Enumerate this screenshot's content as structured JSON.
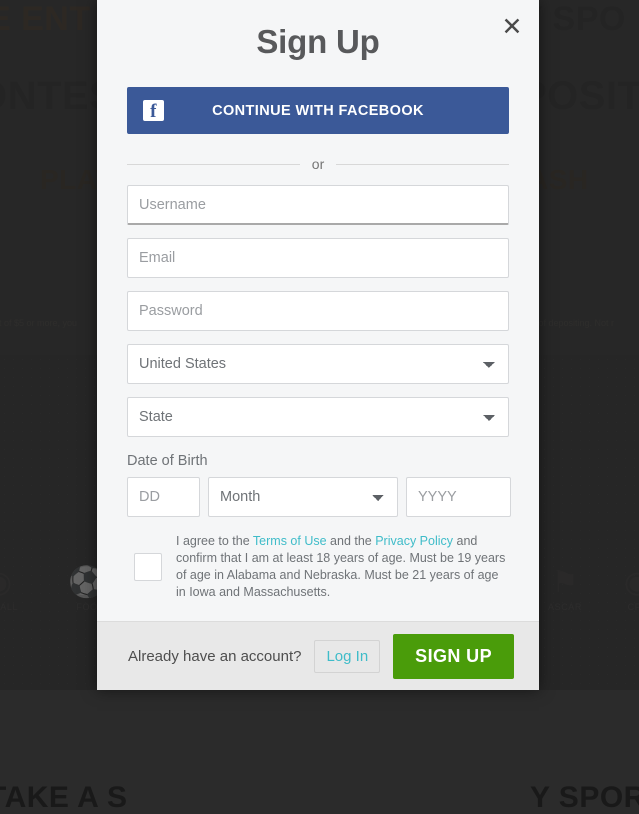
{
  "background": {
    "headline_left_1": "E ENT",
    "headline_right_1": "Y SPO",
    "headline_left_2": "ONTES",
    "headline_right_2": "POSIT",
    "headline_left_3": "PLAY",
    "headline_right_3": "ASH",
    "fine_print_left": "it of $5 or more, you",
    "fine_print_right": "r of depositing. Not r",
    "headline_left_4": "TAKE A S",
    "headline_right_4": "Y SPORTS",
    "sports": [
      {
        "label": "OTBALL",
        "icon": "football-icon",
        "glyph": "◉"
      },
      {
        "label": "FOO",
        "icon": "soccer-ball-icon",
        "glyph": "⚽"
      },
      {
        "label": "ASCAR",
        "icon": "checkered-flag-icon",
        "glyph": "⚑"
      },
      {
        "label": "CFL",
        "icon": "football-icon",
        "glyph": "Ἴ8"
      }
    ]
  },
  "modal": {
    "title": "Sign Up",
    "close_icon": "close-icon",
    "facebook": {
      "label": "CONTINUE WITH FACEBOOK",
      "icon": "facebook-icon",
      "mark": "f",
      "color": "#3b5998"
    },
    "divider_label": "or",
    "fields": {
      "username_placeholder": "Username",
      "username_value": "",
      "email_placeholder": "Email",
      "email_value": "",
      "password_placeholder": "Password",
      "password_value": "",
      "country_value": "United States",
      "state_value": "State"
    },
    "dob": {
      "label": "Date of Birth",
      "day_placeholder": "DD",
      "day_value": "",
      "month_value": "Month",
      "year_placeholder": "YYYY",
      "year_value": ""
    },
    "terms": {
      "part1": "I agree to the ",
      "terms_link": "Terms of Use",
      "part2": " and the ",
      "privacy_link": "Privacy Policy",
      "part3": " and confirm that I am at least 18 years of age. Must be 19 years of age in Alabama and Nebraska. Must be 21 years of age in Iowa and Massachusetts.",
      "checked": false,
      "link_color": "#3fbcc9"
    },
    "footer": {
      "prompt": "Already have an account?",
      "login_label": "Log In",
      "signup_label": "SIGN UP",
      "signup_color": "#4a9c0a"
    }
  }
}
